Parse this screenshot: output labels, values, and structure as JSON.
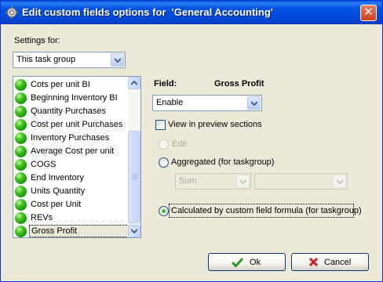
{
  "title": "Edit custom fields options for  'General Accounting'",
  "settings_for": {
    "label": "Settings for:",
    "selected": "This task group"
  },
  "fields": [
    "Cots per unit BI",
    "Beginning Inventory BI",
    "Quantity Purchases",
    "Cost per unit Purchases",
    "Inventory Purchases",
    "Average Cost per unit",
    "COGS",
    "End Inventory",
    "Units Quantity",
    "Cost per Unit",
    "REVs",
    "Gross Profit"
  ],
  "selected_field_index": 11,
  "field_panel": {
    "field_label": "Field:",
    "field_name": "Gross Profit",
    "mode": "Enable",
    "view_in_preview_label": "View in preview sections",
    "view_in_preview_checked": false,
    "edit_label": "Edit",
    "aggregated_label": "Aggregated (for taskgroup)",
    "aggregate_function": "Sum",
    "aggregate_target": "",
    "calculated_label": "Calculated by custom field formula (for taskgroup)",
    "selected_option": "calculated"
  },
  "buttons": {
    "ok": "Ok",
    "cancel": "Cancel"
  },
  "colors": {
    "titlebar": "#0055e5",
    "dialog_bg": "#ece9d8",
    "status_dot": "#3fc51b",
    "ok_check": "#2a9c1c",
    "cancel_x": "#d42020"
  }
}
